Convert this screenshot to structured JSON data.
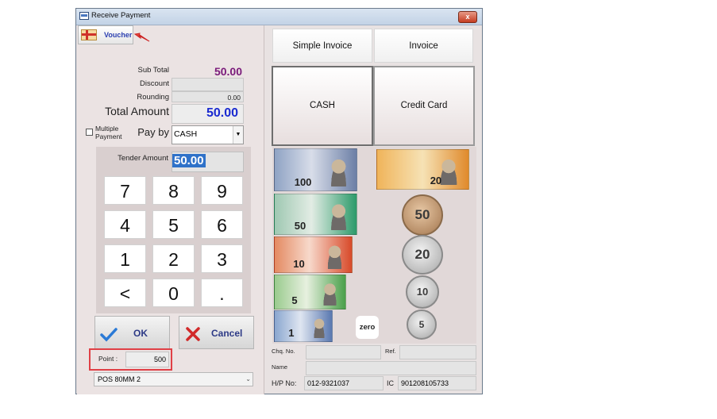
{
  "window": {
    "title": "Receive Payment",
    "close_glyph": "x"
  },
  "voucher": {
    "label": "Voucher",
    "icon": "voucher-icon"
  },
  "summary": {
    "subtotal_label": "Sub Total",
    "subtotal_value": "50.00",
    "discount_label": "Discount",
    "discount_value": "",
    "rounding_label": "Rounding",
    "rounding_value": "0.00",
    "total_label": "Total Amount",
    "total_value": "50.00"
  },
  "multiple_payment_label": "Multiple Payment",
  "payby": {
    "label": "Pay by",
    "selected": "CASH"
  },
  "tender": {
    "label": "Tender Amount",
    "value": "50.00"
  },
  "keypad": {
    "keys": [
      "7",
      "8",
      "9",
      "4",
      "5",
      "6",
      "1",
      "2",
      "3",
      "<",
      "0",
      "."
    ]
  },
  "actions": {
    "ok_label": "OK",
    "cancel_label": "Cancel"
  },
  "point": {
    "label": "Point :",
    "value": "500"
  },
  "printer": {
    "selected": "POS 80MM 2"
  },
  "invoice_buttons": {
    "simple_invoice": "Simple Invoice",
    "invoice": "Invoice"
  },
  "payment_methods": {
    "cash": "CASH",
    "credit_card": "Credit Card"
  },
  "banknotes": [
    "100",
    "50",
    "10",
    "5",
    "1",
    "20"
  ],
  "coins": [
    "50",
    "20",
    "10",
    "5"
  ],
  "zero_label": "zero",
  "details": {
    "chq_label": "Chq. No.",
    "chq_value": "",
    "ref_label": "Ref.",
    "ref_value": "",
    "name_label": "Name",
    "name_value": "",
    "hp_label": "H/P No:",
    "hp_value": "012-9321037",
    "ic_label": "IC",
    "ic_value": "901208105733"
  },
  "colors": {
    "total_blue": "#1a2ad0",
    "subtotal_purple": "#7a1a7a",
    "highlight_red": "#e04046"
  }
}
